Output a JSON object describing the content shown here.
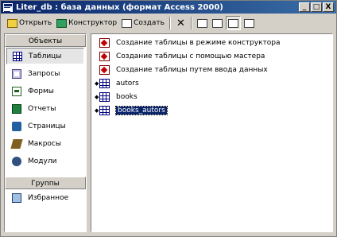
{
  "window": {
    "title": "Liter_db : база данных (формат Access 2000)",
    "minimize": "_",
    "maximize": "□",
    "close": "X"
  },
  "toolbar": {
    "open": {
      "label": "Открыть",
      "icon": "open-icon"
    },
    "design": {
      "label": "Конструктор",
      "icon": "design-icon"
    },
    "create": {
      "label": "Создать",
      "icon": "create-icon"
    },
    "delete": {
      "icon": "delete-icon",
      "glyph": "✕"
    },
    "views": [
      "large-icons-view-icon",
      "small-icons-view-icon",
      "list-view-icon",
      "details-view-icon"
    ]
  },
  "sidebar": {
    "objects_header": "Объекты",
    "items": [
      {
        "label": "Таблицы",
        "icon": "table-icon",
        "selected": true
      },
      {
        "label": "Запросы",
        "icon": "query-icon"
      },
      {
        "label": "Формы",
        "icon": "form-icon"
      },
      {
        "label": "Отчеты",
        "icon": "report-icon"
      },
      {
        "label": "Страницы",
        "icon": "page-icon"
      },
      {
        "label": "Макросы",
        "icon": "macro-icon"
      },
      {
        "label": "Модули",
        "icon": "module-icon"
      }
    ],
    "groups_header": "Группы",
    "groups": [
      {
        "label": "Избранное",
        "icon": "favorites-icon"
      }
    ]
  },
  "list": {
    "items": [
      {
        "label": "Создание таблицы в режиме конструктора",
        "icon": "wizard-icon",
        "shortcut": false
      },
      {
        "label": "Создание таблицы с помощью мастера",
        "icon": "wizard-icon",
        "shortcut": false
      },
      {
        "label": "Создание таблицы путем ввода данных",
        "icon": "wizard-icon",
        "shortcut": false
      },
      {
        "label": "autors",
        "icon": "table-icon",
        "shortcut": true
      },
      {
        "label": "books",
        "icon": "table-icon",
        "shortcut": true
      },
      {
        "label": "books_autors",
        "icon": "table-icon",
        "shortcut": true,
        "selected": true
      }
    ]
  }
}
